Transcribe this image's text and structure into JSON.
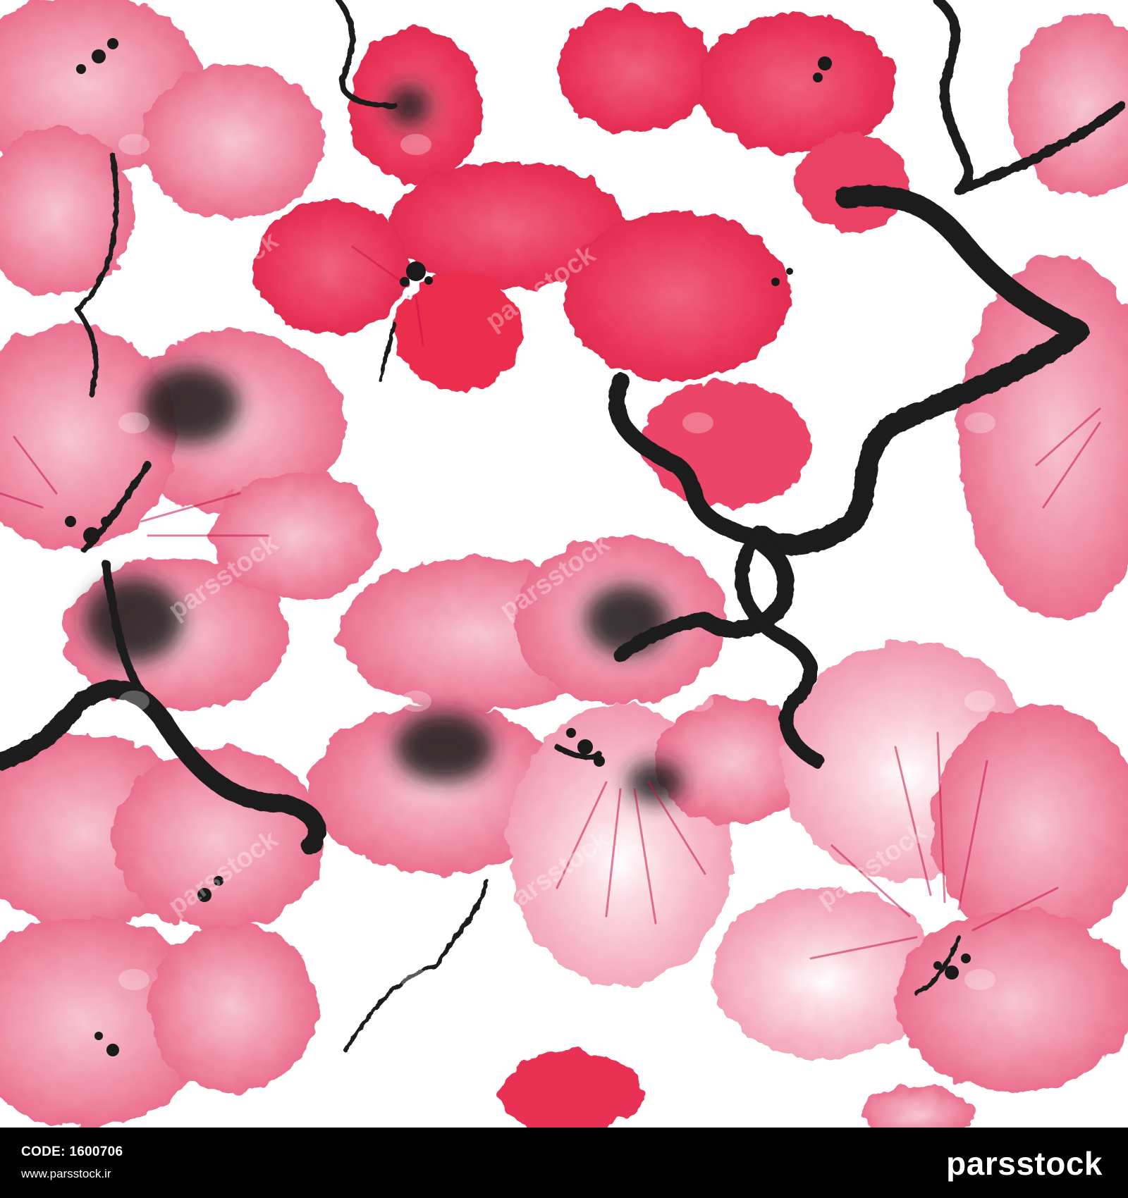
{
  "image": {
    "subject": "Seamless watercolor pattern with pink and red blossoms and black ink branches",
    "colors": {
      "background": "#ffffff",
      "petal_pink": "#f0809a",
      "petal_light": "#f6a9bb",
      "petal_red": "#e8284e",
      "ink": "#1a1a1a",
      "footer_bg": "#000000",
      "footer_text": "#ffffff"
    }
  },
  "watermark": {
    "text": "parsstock",
    "logo_icon": "elephant-icon"
  },
  "footer": {
    "code_label": "CODE:",
    "code_value": "1600706",
    "url": "www.parsstock.ir",
    "brand": "parsstock"
  }
}
